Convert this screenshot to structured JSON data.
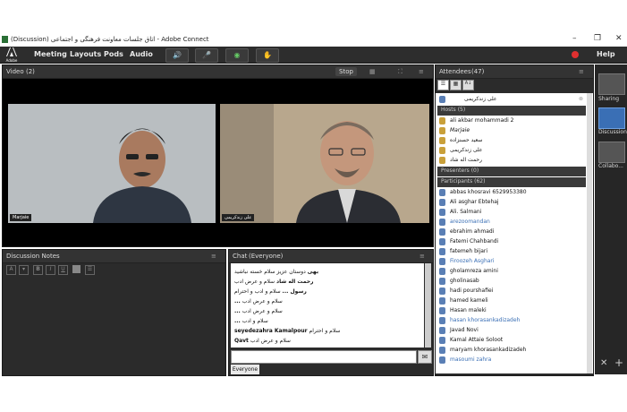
{
  "window": {
    "title": "(Discussion) اتاق جلسات معاونت فرهنگی و اجتماعی - Adobe Connect",
    "minimize": "–",
    "maximize": "❐",
    "close": "✕"
  },
  "menubar": {
    "logo_text": "Adobe",
    "items": [
      "Meeting",
      "Layouts",
      "Pods",
      "Audio"
    ],
    "help": "Help"
  },
  "video": {
    "title": "Video",
    "count": "(2)",
    "stop_label": "Stop",
    "left_label": "Marjaie",
    "right_label": "علی زندکریمی"
  },
  "notes": {
    "title": "Discussion Notes"
  },
  "chat": {
    "title": "Chat",
    "scope": "(Everyone)",
    "messages": [
      {
        "author": "بهی",
        "text": "دوستان عزیز سلام خسته نباشید"
      },
      {
        "author": "رحمت اله شاد",
        "text": "سلام و عرض ادب"
      },
      {
        "author": "رسول ...",
        "text": "سلام و ادب و احترام"
      },
      {
        "author": "...",
        "text": "سلام و عرض ادب"
      },
      {
        "author": "...",
        "text": "سلام و عرض ادب"
      },
      {
        "author": "...",
        "text": "سلام و ادب"
      },
      {
        "author": "seyedezahra Kamalpour",
        "text": "سلام و احترام"
      },
      {
        "author": "Qavt",
        "text": "سلام و عرض ادب"
      }
    ],
    "tab": "Everyone"
  },
  "attendees": {
    "title": "Attendees",
    "count": "(47)",
    "current_user": "علی زندکریمی",
    "hosts_label": "Hosts (5)",
    "hosts": [
      "ali akbar mohammadi 2",
      "Marjaie",
      "سعید حسنزاده",
      "علی زندکریمی",
      "رحمت اله شاد"
    ],
    "presenters_label": "Presenters (0)",
    "participants_label": "Participants (62)",
    "participants": [
      "abbas khosravi 6529953380",
      "Ali asghar Ebtehaj",
      "Ali. Salmani",
      "arezoomandan",
      "ebrahim ahmadi",
      "Fatemi Chahbandi",
      "fatemeh bijari",
      "Firoozeh Asghari",
      "gholamreza amini",
      "gholinasab",
      "hadi pourshafiei",
      "hamed kameli",
      "Hasan maleki",
      "hasan khorasankadizadeh",
      "Javad Novi",
      "Kamal Attaie Soloot",
      "maryam khorasankadizadeh",
      "masoumi zahra"
    ]
  },
  "rail": {
    "items": [
      "Sharing",
      "Discussion",
      "Collabo..."
    ]
  }
}
